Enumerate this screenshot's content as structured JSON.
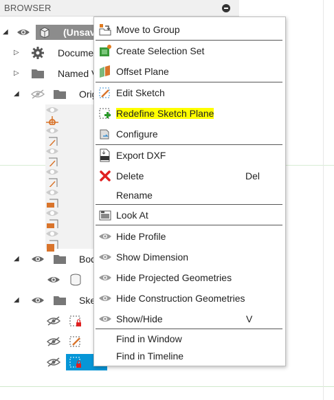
{
  "browser": {
    "title": "BROWSER",
    "rows": [
      {
        "label": "(Unsaved)",
        "display": "(Unsav"
      },
      {
        "label": "Document Settings",
        "display": "Docume"
      },
      {
        "label": "Named Views",
        "display": "Named V"
      },
      {
        "label": "Origin",
        "display": "Origi"
      },
      {
        "label": "Bodies",
        "display": "Bod"
      },
      {
        "label": "Sketches",
        "display": "Ske"
      }
    ]
  },
  "menu": {
    "items": [
      {
        "label": "Move to Group",
        "icon": "move-to-group-icon"
      },
      {
        "label": "Create Selection Set",
        "icon": "selection-set-icon"
      },
      {
        "label": "Offset Plane",
        "icon": "offset-plane-icon"
      },
      {
        "label": "Edit Sketch",
        "icon": "edit-sketch-icon"
      },
      {
        "label": "Redefine Sketch Plane",
        "icon": "redefine-plane-icon",
        "highlight": "#ffff00"
      },
      {
        "label": "Configure",
        "icon": "configure-icon"
      },
      {
        "label": "Export DXF",
        "icon": "dxf-icon"
      },
      {
        "label": "Delete",
        "icon": "delete-icon",
        "shortcut": "Del"
      },
      {
        "label": "Rename"
      },
      {
        "label": "Look At",
        "icon": "look-at-icon"
      },
      {
        "label": "Hide Profile",
        "icon": "eye-icon"
      },
      {
        "label": "Show Dimension",
        "icon": "eye-icon"
      },
      {
        "label": "Hide Projected Geometries",
        "icon": "eye-icon"
      },
      {
        "label": "Hide Construction Geometries",
        "icon": "eye-icon"
      },
      {
        "label": "Show/Hide",
        "icon": "eye-icon",
        "shortcut": "V"
      },
      {
        "label": "Find in Window"
      },
      {
        "label": "Find in Timeline"
      }
    ]
  },
  "colors": {
    "accent": "#0696d7",
    "delete_red": "#e02020",
    "origin_orange": "#d9742b",
    "highlight": "#ffff00"
  }
}
